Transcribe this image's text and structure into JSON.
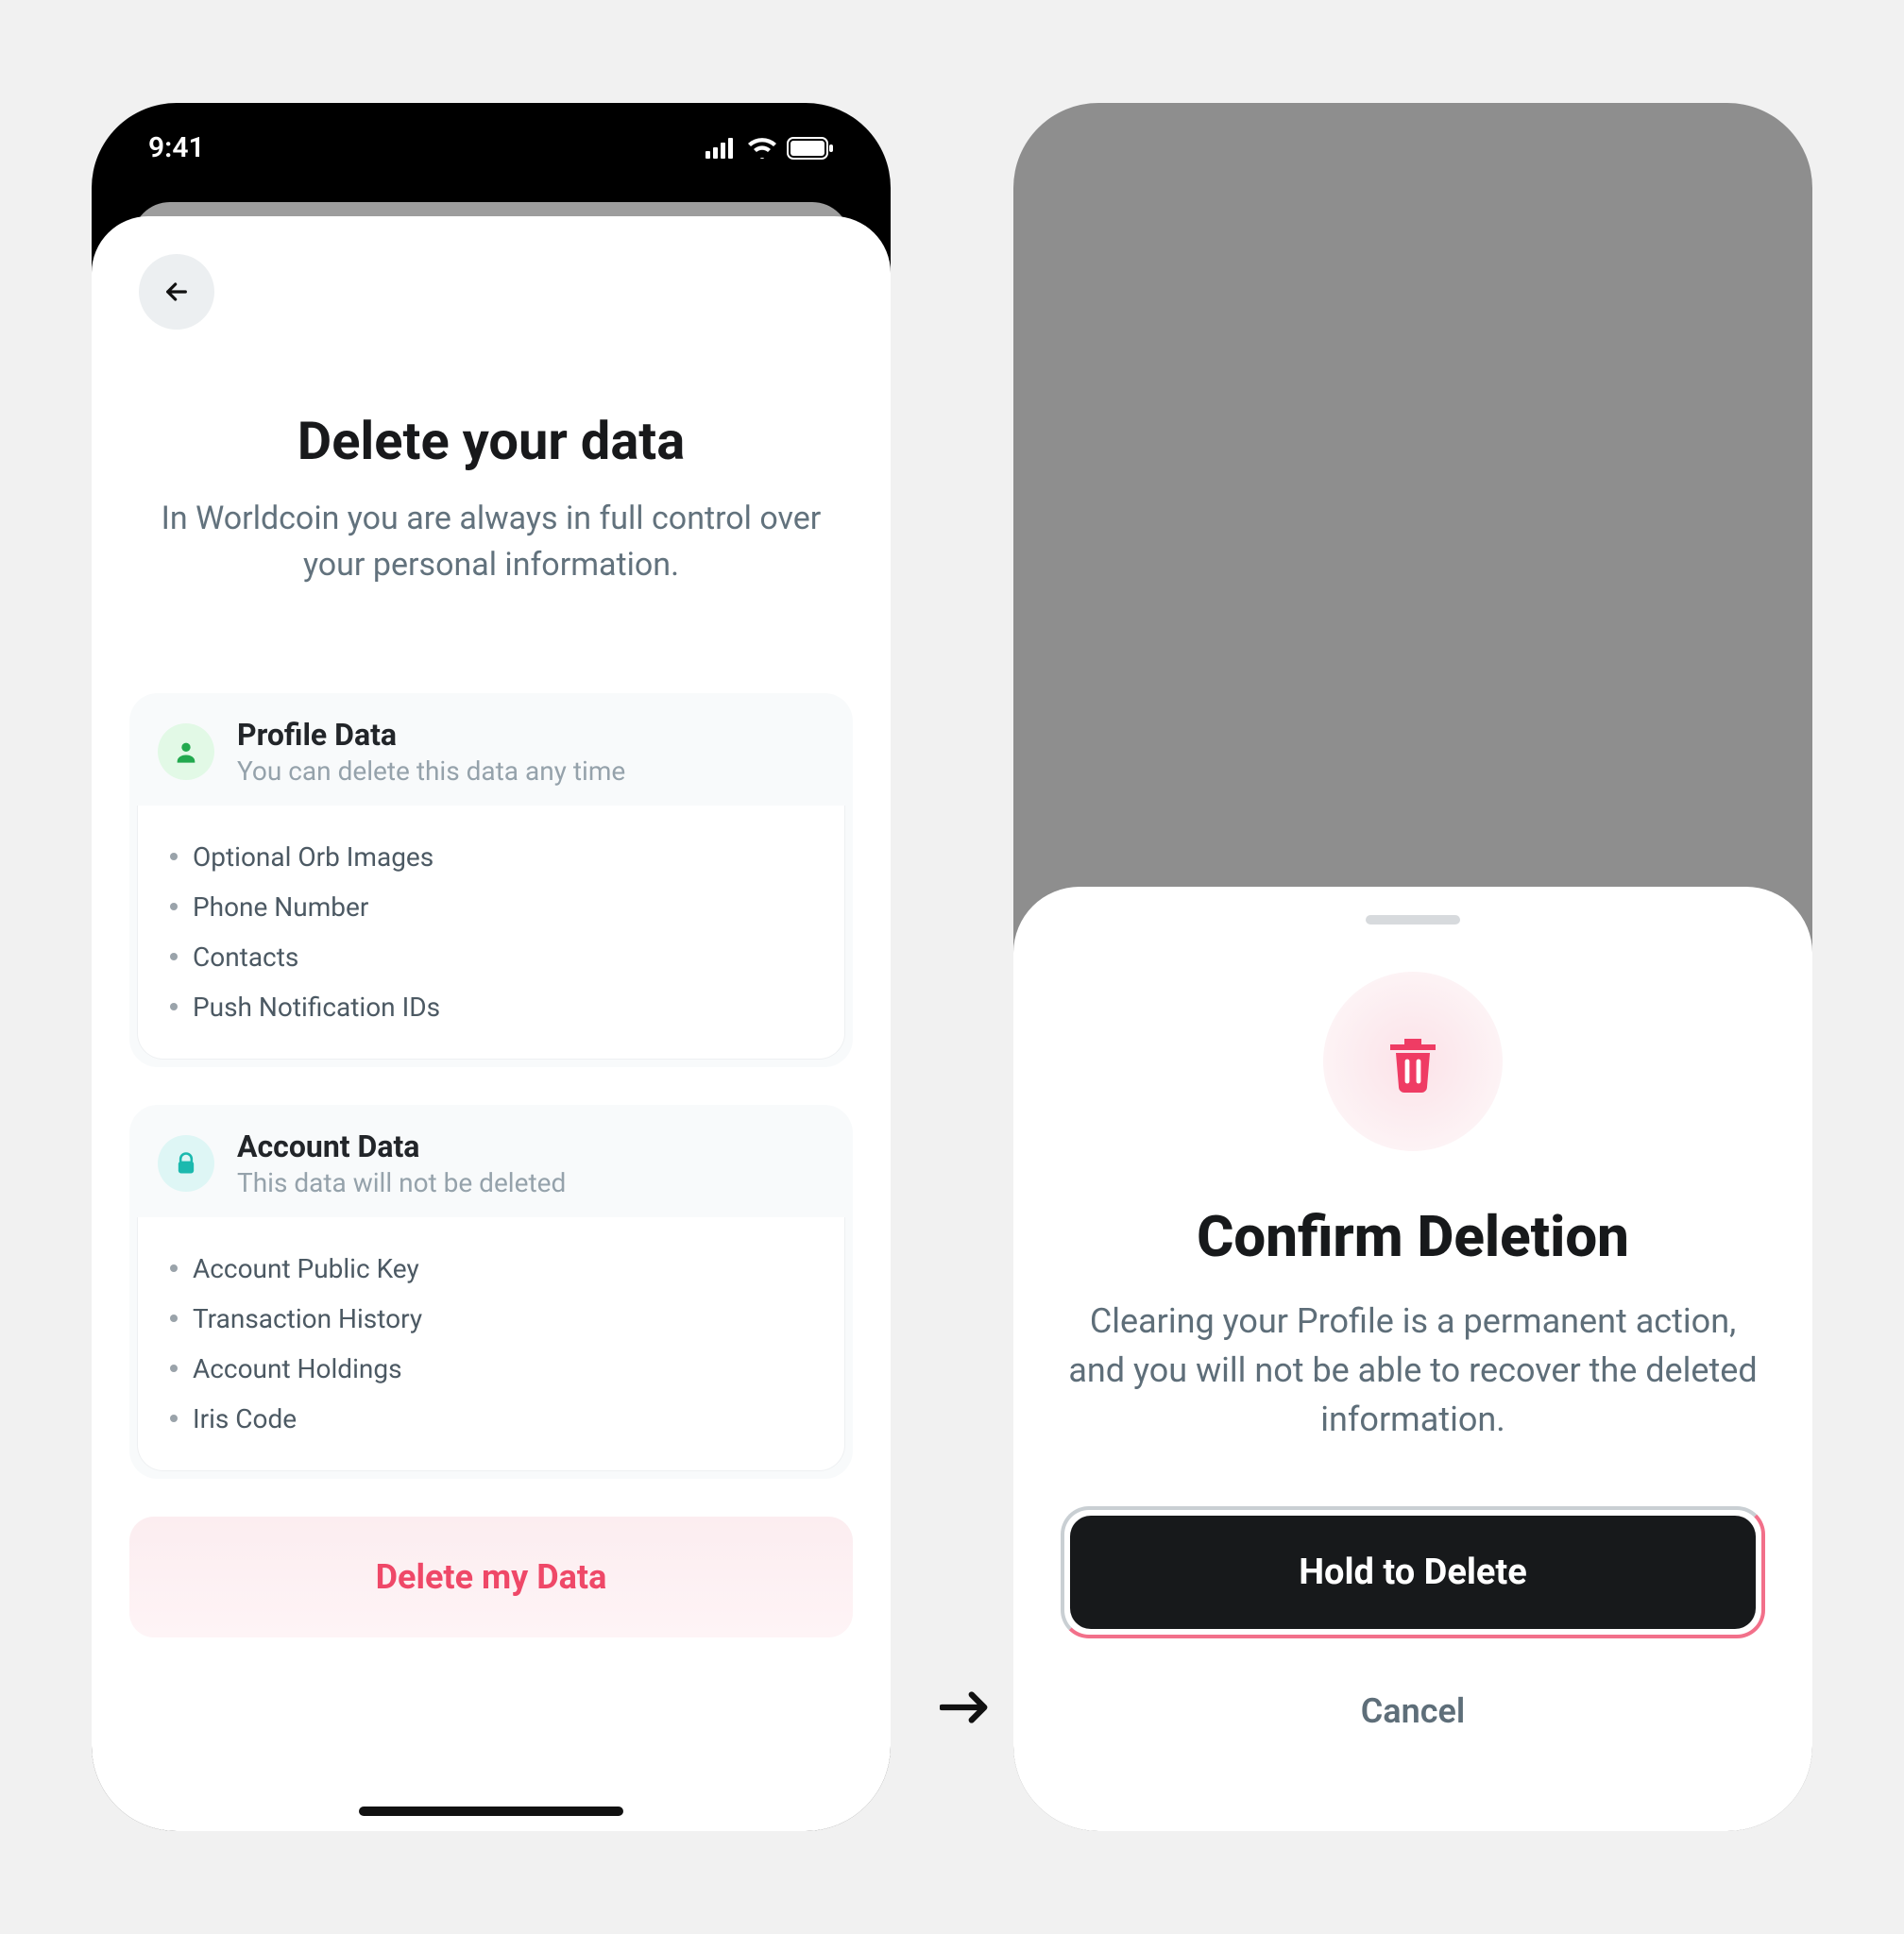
{
  "statusBar": {
    "time": "9:41"
  },
  "left": {
    "title": "Delete your data",
    "subtitle": "In Worldcoin you are always in full control over your personal information.",
    "sections": [
      {
        "icon": "person",
        "title": "Profile Data",
        "subtitle": "You can delete this data any time",
        "items": [
          "Optional Orb Images",
          "Phone Number",
          "Contacts",
          "Push Notification IDs"
        ]
      },
      {
        "icon": "lock",
        "title": "Account Data",
        "subtitle": "This data will not be deleted",
        "items": [
          "Account Public Key",
          "Transaction History",
          "Account Holdings",
          "Iris Code"
        ]
      }
    ],
    "deleteButton": "Delete my Data"
  },
  "right": {
    "title": "Confirm Deletion",
    "body": "Clearing your Profile is a permanent action, and you will not be able to recover the deleted information.",
    "holdButton": "Hold to Delete",
    "cancel": "Cancel"
  },
  "colors": {
    "accentRed": "#ef4868",
    "accentTeal": "#1bb9ae",
    "accentGreen": "#22a94e"
  }
}
